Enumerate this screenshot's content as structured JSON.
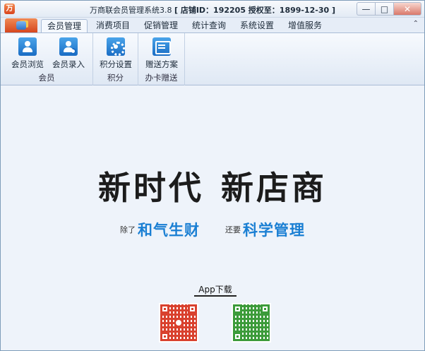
{
  "window": {
    "title_prefix": "万商联会员管理系统3.8",
    "title_info": "[ 店铺ID：192205 授权至：1899-12-30 ]",
    "minimize_label": "—",
    "maximize_label": "□",
    "close_label": "✕",
    "logo_glyph": "万"
  },
  "tabs": [
    {
      "label": "会员管理",
      "active": true
    },
    {
      "label": "消费项目"
    },
    {
      "label": "促销管理"
    },
    {
      "label": "统计查询"
    },
    {
      "label": "系统设置"
    },
    {
      "label": "增值服务"
    }
  ],
  "ribbon_min_glyph": "⌃",
  "ribbon": {
    "groups": [
      {
        "label": "会员",
        "buttons": [
          {
            "label": "会员浏览",
            "icon": "member-browse-icon"
          },
          {
            "label": "会员录入",
            "icon": "member-add-icon"
          }
        ]
      },
      {
        "label": "积分",
        "buttons": [
          {
            "label": "积分设置",
            "icon": "points-settings-icon"
          }
        ]
      },
      {
        "label": "办卡赠送",
        "buttons": [
          {
            "label": "赠送方案",
            "icon": "gift-plan-icon"
          }
        ]
      }
    ]
  },
  "main": {
    "slogan_left": "新时代",
    "slogan_right": "新店商",
    "sub_prefix1": "除了",
    "sub_big1": "和气生财",
    "sub_prefix2": "还要",
    "sub_big2": "科学管理",
    "app_download": "App下载"
  },
  "colors": {
    "accent_blue": "#1a7fd3",
    "qr_left": "#d9412e",
    "qr_right": "#3c9b3a"
  }
}
